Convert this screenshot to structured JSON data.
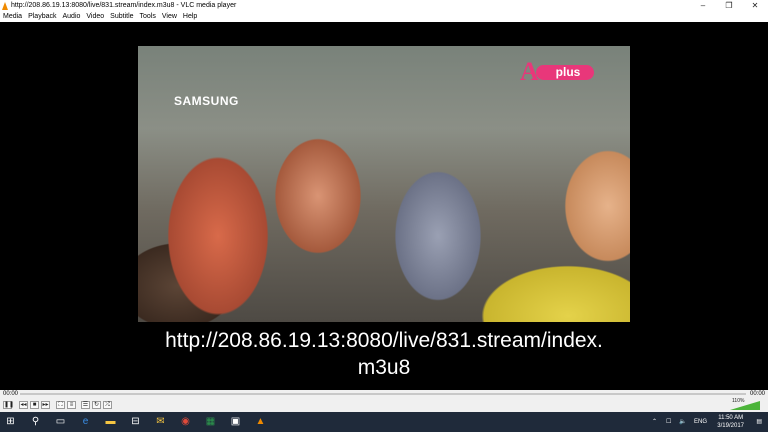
{
  "window": {
    "title": "http://208.86.19.13:8080/live/831.stream/index.m3u8 - VLC media player",
    "minimize": "–",
    "maximize": "❐",
    "close": "✕"
  },
  "menu": [
    "Media",
    "Playback",
    "Audio",
    "Video",
    "Subtitle",
    "Tools",
    "View",
    "Help"
  ],
  "video": {
    "brand_overlay": "SAMSUNG",
    "channel_logo_letter": "A",
    "channel_logo_text": "plus",
    "subtitle_line1": "http://208.86.19.13:8080/live/831.stream/index.",
    "subtitle_line2": "m3u8"
  },
  "playback": {
    "elapsed": "00:00",
    "remaining": "00:00",
    "volume_label": "110%",
    "volume_level_percent": 110
  },
  "taskbar": {
    "language": "ENG",
    "time": "11:50 AM",
    "date": "3/19/2017"
  },
  "colors": {
    "accent_vlc": "#f08a00",
    "channel_pink": "#e8377a",
    "volume_green": "#4cb43a",
    "taskbar_bg": "#1f2a3a"
  },
  "icons": [
    "vlc-cone-icon",
    "play-pause-icon",
    "previous-icon",
    "stop-icon",
    "next-icon",
    "fullscreen-icon",
    "extended-settings-icon",
    "playlist-icon",
    "loop-icon",
    "shuffle-icon",
    "start-icon",
    "search-icon",
    "task-view-icon",
    "edge-icon",
    "file-explorer-icon",
    "store-icon",
    "outlook-icon",
    "chrome-icon",
    "excel-icon",
    "app-icon",
    "vlc-taskbar-icon"
  ]
}
